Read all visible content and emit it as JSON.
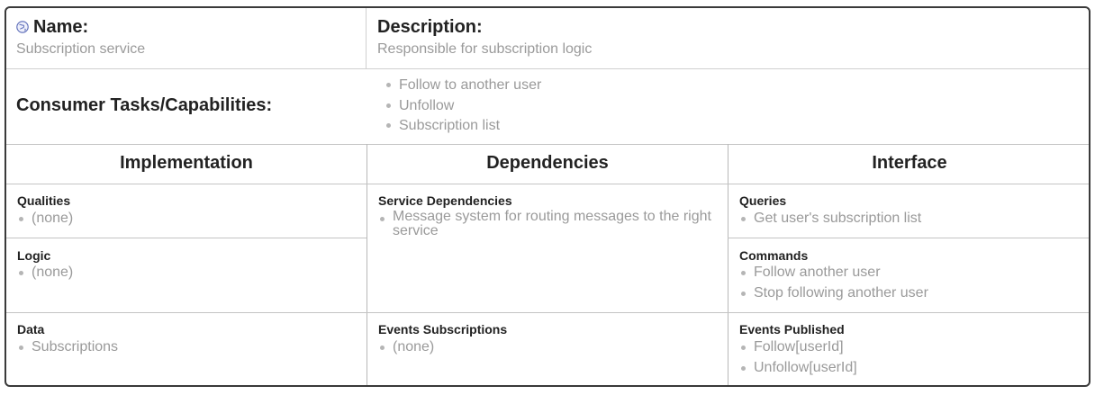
{
  "header": {
    "name_label": "Name:",
    "name_value": "Subscription service",
    "description_label": "Description:",
    "description_value": "Responsible for subscription logic"
  },
  "capabilities": {
    "label": "Consumer Tasks/Capabilities:",
    "items": [
      "Follow to another user",
      "Unfollow",
      "Subscription list"
    ]
  },
  "columns": {
    "implementation": "Implementation",
    "dependencies": "Dependencies",
    "interface": "Interface"
  },
  "implementation": {
    "qualities": {
      "title": "Qualities",
      "items": [
        "(none)"
      ]
    },
    "logic": {
      "title": "Logic",
      "items": [
        "(none)"
      ]
    },
    "data": {
      "title": "Data",
      "items": [
        "Subscriptions"
      ]
    }
  },
  "dependencies": {
    "service": {
      "title": "Service Dependencies",
      "items": [
        "Message system for routing messages to the right service"
      ]
    },
    "events": {
      "title": "Events Subscriptions",
      "items": [
        "(none)"
      ]
    }
  },
  "interface": {
    "queries": {
      "title": "Queries",
      "items": [
        "Get user's subscription list"
      ]
    },
    "commands": {
      "title": "Commands",
      "items": [
        "Follow another user",
        "Stop following another user"
      ]
    },
    "events": {
      "title": "Events Published",
      "items": [
        "Follow[userId]",
        "Unfollow[userId]"
      ]
    }
  },
  "icons": {
    "name_icon": "globe-icon"
  },
  "colors": {
    "border": "#3a3a3a",
    "muted_text": "#9a9a9a",
    "heading_text": "#222222",
    "globe": "#5b6bb8"
  }
}
